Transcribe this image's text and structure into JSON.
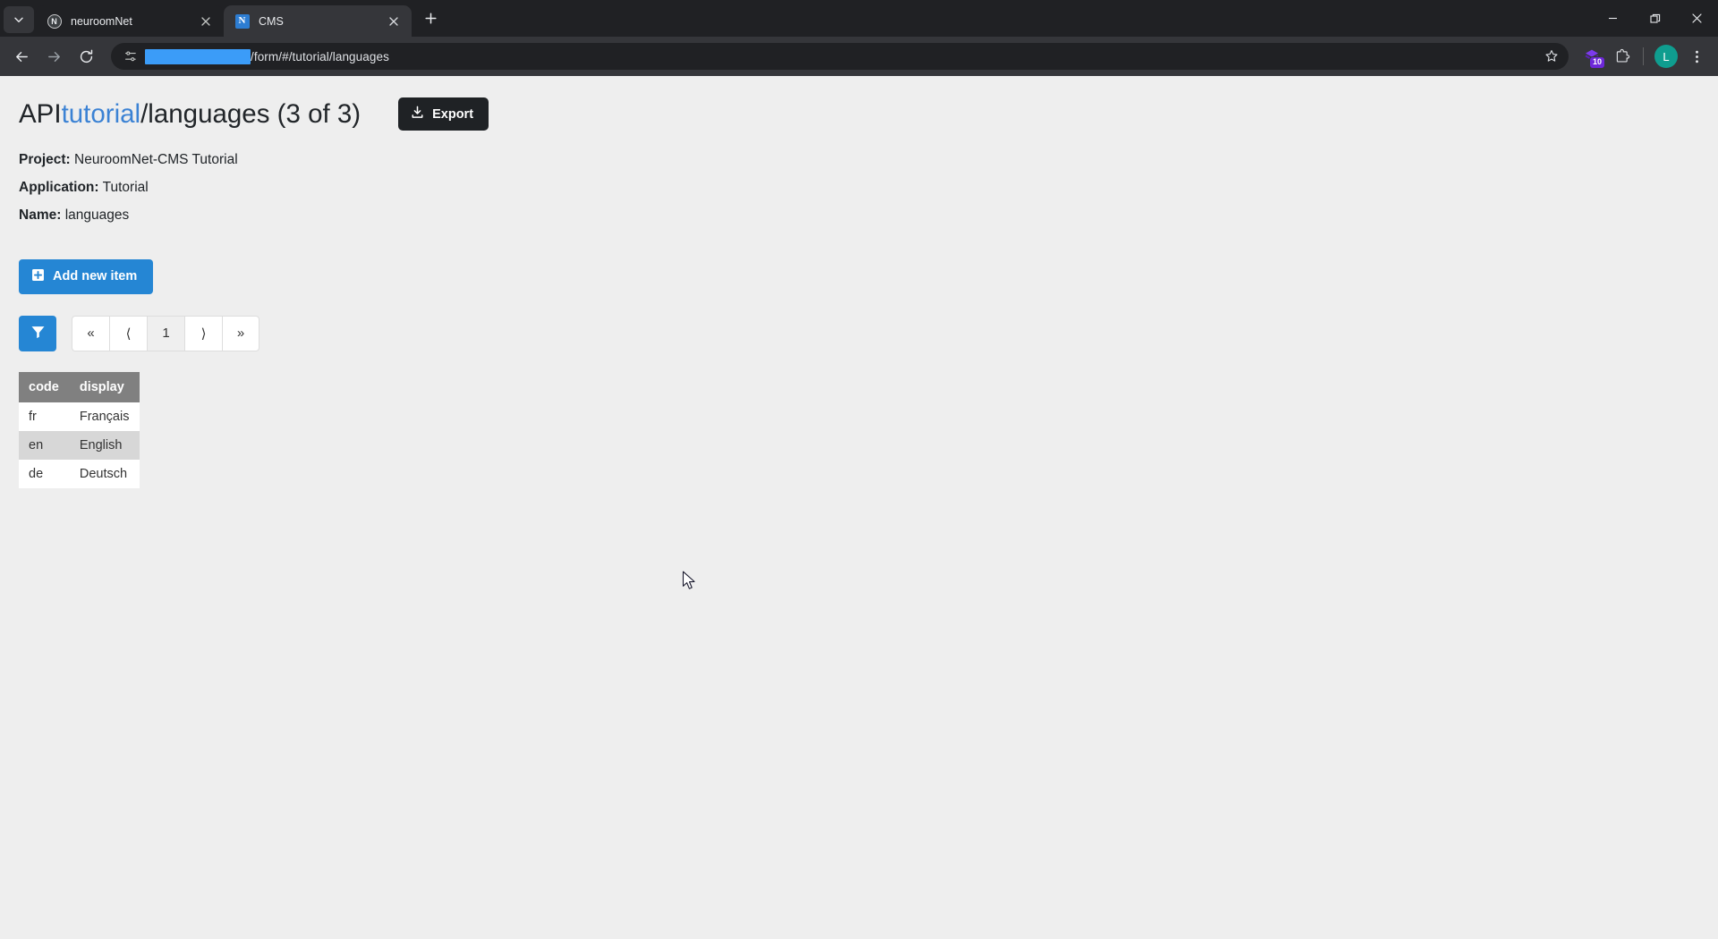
{
  "browser": {
    "tabs": [
      {
        "title": "neuroomNet",
        "favicon": "neuroomnet-logo-icon",
        "favicon_letter": "N",
        "active": false
      },
      {
        "title": "CMS",
        "favicon": "cms-logo-icon",
        "favicon_letter": "N",
        "active": true
      }
    ],
    "url": {
      "redacted": true,
      "path": "/form/#/tutorial/languages"
    },
    "toolbar": {
      "back_icon": "back-arrow-icon",
      "forward_icon": "forward-arrow-icon",
      "reload_icon": "reload-icon",
      "site_settings_icon": "site-settings-sliders-icon",
      "bookmark_icon": "star-icon",
      "extension_icon": "extension-purple-icon",
      "extension_badge_count": "10",
      "extensions_icon": "puzzle-piece-icon",
      "profile_initial": "L",
      "menu_icon": "three-dot-menu-icon"
    },
    "window_controls": {
      "minimize": "minimize-icon",
      "maximize": "restore-icon",
      "close": "close-icon"
    },
    "new_tab_label": "+",
    "tab_search_icon": "chevron-down-icon"
  },
  "page": {
    "title": {
      "prefix": "API ",
      "accent": "tutorial",
      "suffix": "/languages (3 of 3)"
    },
    "export_label": "Export",
    "export_icon": "download-icon",
    "meta": [
      {
        "label": "Project:",
        "value": "NeuroomNet-CMS Tutorial"
      },
      {
        "label": "Application:",
        "value": "Tutorial"
      },
      {
        "label": "Name:",
        "value": "languages"
      }
    ],
    "add_item_label": "Add new item",
    "add_item_icon": "plus-square-icon",
    "filter_icon": "funnel-icon",
    "pagination": {
      "first": "«",
      "prev": "⟨",
      "current": "1",
      "next": "⟩",
      "last": "»"
    },
    "table": {
      "columns": [
        "code",
        "display"
      ],
      "rows": [
        [
          "fr",
          "Français"
        ],
        [
          "en",
          "English"
        ],
        [
          "de",
          "Deutsch"
        ]
      ]
    }
  },
  "colors": {
    "accent_blue": "#3b82d4",
    "button_blue": "#2586d4",
    "dark_button": "#1f2225",
    "table_header_gray": "#808080",
    "page_background": "#eeeeee"
  }
}
